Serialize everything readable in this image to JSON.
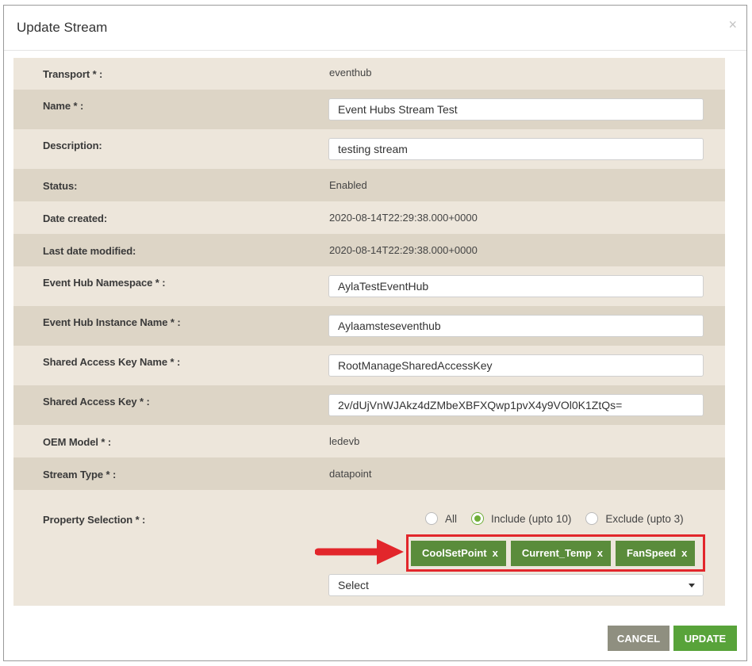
{
  "dialog": {
    "title": "Update Stream",
    "close": "×"
  },
  "fields": {
    "transport": {
      "label": "Transport * :",
      "value": "eventhub"
    },
    "name": {
      "label": "Name * :",
      "value": "Event Hubs Stream Test"
    },
    "description": {
      "label": "Description:",
      "value": "testing stream"
    },
    "status": {
      "label": "Status:",
      "value": "Enabled"
    },
    "date_created": {
      "label": "Date created:",
      "value": "2020-08-14T22:29:38.000+0000"
    },
    "last_modified": {
      "label": "Last date modified:",
      "value": "2020-08-14T22:29:38.000+0000"
    },
    "namespace": {
      "label": "Event Hub Namespace * :",
      "value": "AylaTestEventHub"
    },
    "instance": {
      "label": "Event Hub Instance Name * :",
      "value": "Aylaamsteseventhub"
    },
    "key_name": {
      "label": "Shared Access Key Name * :",
      "value": "RootManageSharedAccessKey"
    },
    "key": {
      "label": "Shared Access Key * :",
      "value": "2v/dUjVnWJAkz4dZMbeXBFXQwp1pvX4y9VOl0K1ZtQs="
    },
    "oem_model": {
      "label": "OEM Model * :",
      "value": "ledevb"
    },
    "stream_type": {
      "label": "Stream Type * :",
      "value": "datapoint"
    }
  },
  "property_selection": {
    "label": "Property Selection * :",
    "radios": [
      {
        "label": "All",
        "checked": false
      },
      {
        "label": "Include (upto 10)",
        "checked": true
      },
      {
        "label": "Exclude (upto 3)",
        "checked": false
      }
    ],
    "chips": [
      "CoolSetPoint",
      "Current_Temp",
      "FanSpeed"
    ],
    "chip_remove": "x",
    "select_value": "Select"
  },
  "buttons": {
    "cancel": "CANCEL",
    "update": "UPDATE"
  },
  "colors": {
    "accent_green": "#58a33a",
    "chip_green": "#5a8c3b",
    "highlight_red": "#e2262b"
  }
}
